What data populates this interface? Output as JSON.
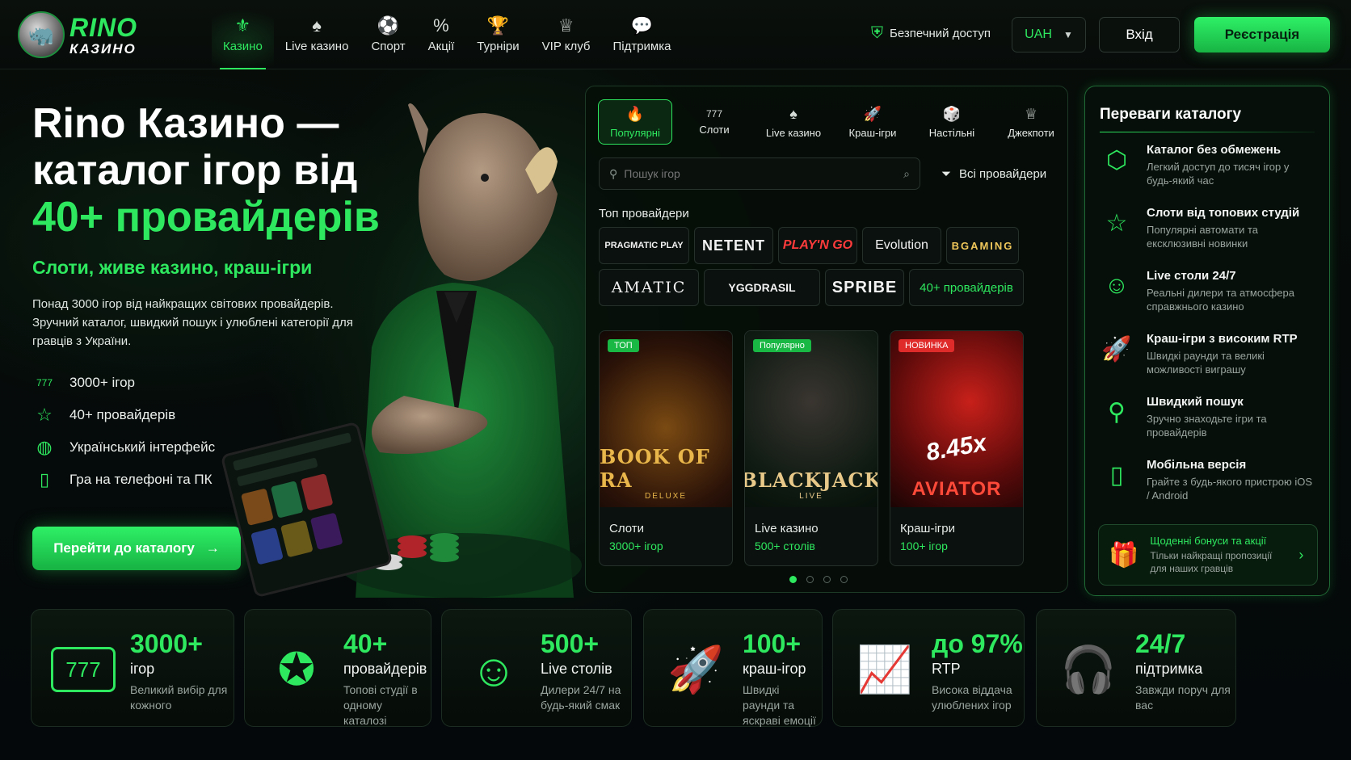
{
  "brand": {
    "name": "RINO",
    "sub": "КАЗИНО"
  },
  "nav": [
    {
      "label": "Казино",
      "icon": "⚜",
      "active": true
    },
    {
      "label": "Live казино",
      "icon": "♠"
    },
    {
      "label": "Спорт",
      "icon": "⚽"
    },
    {
      "label": "Акції",
      "icon": "%"
    },
    {
      "label": "Турніри",
      "icon": "🏆"
    },
    {
      "label": "VIP клуб",
      "icon": "♕"
    },
    {
      "label": "Підтримка",
      "icon": "💬"
    }
  ],
  "header": {
    "secure": "Безпечний доступ",
    "currency": "UAH",
    "login": "Вхід",
    "register": "Реєстрація"
  },
  "hero": {
    "title_line1": "Rino Казино —",
    "title_line2": "каталог ігор від",
    "title_line3": "40+ провайдерів",
    "subtitle": "Слоти, живе казино, краш-ігри",
    "desc": "Понад 3000 ігор від найкращих світових провайдерів. Зручний каталог, швидкий пошук і улюблені категорії для гравців з України.",
    "features": [
      {
        "icon": "777",
        "label": "3000+ ігор"
      },
      {
        "icon": "☆",
        "label": "40+ провайдерів"
      },
      {
        "icon": "◍",
        "label": "Український інтерфейс"
      },
      {
        "icon": "▯",
        "label": "Гра на телефоні та ПК"
      }
    ],
    "cta": "Перейти до каталогу",
    "cta_arrow": "→"
  },
  "catalog": {
    "tabs": [
      {
        "label": "Популярні",
        "icon": "🔥",
        "active": true
      },
      {
        "label": "Слоти",
        "icon": "777"
      },
      {
        "label": "Live казино",
        "icon": "♠"
      },
      {
        "label": "Краш-ігри",
        "icon": "🚀"
      },
      {
        "label": "Настільні",
        "icon": "🎲"
      },
      {
        "label": "Джекпоти",
        "icon": "♕"
      }
    ],
    "search_placeholder": "Пошук ігор",
    "providers_filter": "Всі провайдери",
    "top_label": "Топ провайдери",
    "providers_row1": [
      "PRAGMATIC PLAY",
      "NETENT",
      "PLAY'N GO",
      "Evolution",
      "BGAMING"
    ],
    "providers_row2": [
      "AMATIC",
      "YGGDRASIL",
      "SPRIBE",
      "40+ провайдерів"
    ],
    "games": [
      {
        "badge": "ТОП",
        "badge_color": "#19b845",
        "art_title": "BOOK OF RA",
        "art_sub": "DELUXE",
        "name": "Слоти",
        "count": "3000+ ігор"
      },
      {
        "badge": "Популярно",
        "badge_color": "#19b845",
        "art_title": "BLACKJACK",
        "art_sub": "LIVE",
        "name": "Live казино",
        "count": "500+ столів"
      },
      {
        "badge": "НОВИНКА",
        "badge_color": "#e02b2b",
        "art_title": "AVIATOR",
        "art_sub": "8.45x",
        "name": "Краш-ігри",
        "count": "100+ ігор"
      }
    ],
    "pages": 4,
    "active_page": 0
  },
  "advantages": {
    "title": "Переваги каталогу",
    "items": [
      {
        "icon": "⬡",
        "title": "Каталог без обмежень",
        "desc": "Легкий доступ до тисяч ігор у будь-який час"
      },
      {
        "icon": "☆",
        "title": "Слоти від топових студій",
        "desc": "Популярні автомати та ексклюзивні новинки"
      },
      {
        "icon": "☺",
        "title": "Live столи 24/7",
        "desc": "Реальні дилери та атмосфера справжнього казино"
      },
      {
        "icon": "🚀",
        "title": "Краш-ігри з високим RTP",
        "desc": "Швидкі раунди та великі можливості виграшу"
      },
      {
        "icon": "⚲",
        "title": "Швидкий пошук",
        "desc": "Зручно знаходьте ігри та провайдерів"
      },
      {
        "icon": "▯",
        "title": "Мобільна версія",
        "desc": "Грайте з будь-якого пристрою iOS / Android"
      }
    ],
    "bonus": {
      "icon": "🎁",
      "title": "Щоденні бонуси та акції",
      "desc": "Тільки найкращі пропозиції для наших гравців",
      "arrow": "›"
    }
  },
  "stats": [
    {
      "icon": "777",
      "num": "3000+",
      "unit": "ігор",
      "desc": "Великий вибір для кожного"
    },
    {
      "icon": "✪",
      "num": "40+",
      "unit": "провайдерів",
      "desc": "Топові студії в одному каталозі"
    },
    {
      "icon": "☺",
      "num": "500+",
      "unit": "Live столів",
      "desc": "Дилери 24/7 на будь-який смак"
    },
    {
      "icon": "🚀",
      "num": "100+",
      "unit": "краш-ігор",
      "desc": "Швидкі раунди та яскраві емоції"
    },
    {
      "icon": "📈",
      "num": "до 97%",
      "unit": "RTP",
      "desc": "Висока віддача улюблених ігор"
    },
    {
      "icon": "🎧",
      "num": "24/7",
      "unit": "підтримка",
      "desc": "Завжди поруч для вас"
    }
  ],
  "colors": {
    "accent": "#2ee85f",
    "background": "#050a07",
    "new_badge": "#e02b2b"
  }
}
